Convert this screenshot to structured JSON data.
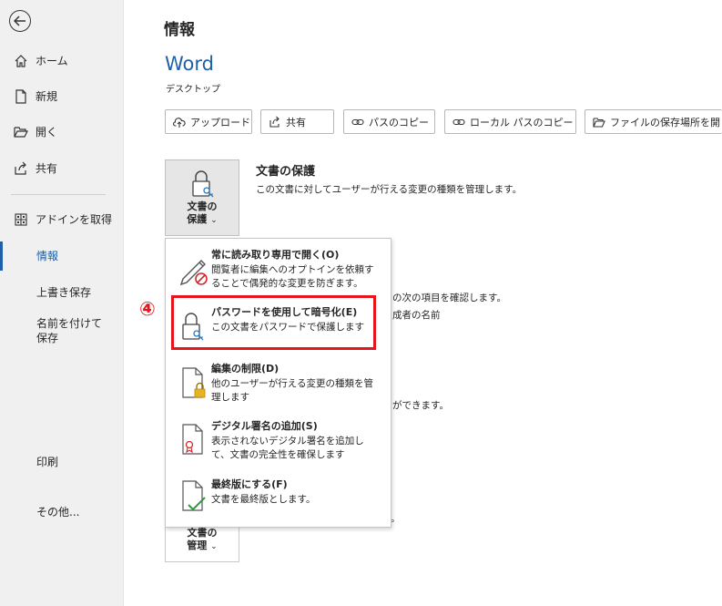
{
  "sidebar": {
    "home": "ホーム",
    "new": "新規",
    "open": "開く",
    "share": "共有",
    "get_addins": "アドインを取得",
    "info": "情報",
    "save": "上書き保存",
    "save_as": "名前を付けて保存",
    "print": "印刷",
    "more": "その他..."
  },
  "page": {
    "title": "情報",
    "app_name": "Word",
    "app_sub": "デスクトップ"
  },
  "toolbar": {
    "upload": "アップロード",
    "share": "共有",
    "copy_path": "パスのコピー",
    "copy_local_path": "ローカル パスのコピー",
    "open_location": "ファイルの保存場所を開"
  },
  "protect": {
    "button_label_1": "文書の",
    "button_label_2": "保護",
    "chevron": "⌄",
    "title": "文書の保護",
    "desc": "この文書に対してユーザーが行える変更の種類を管理します。"
  },
  "background": {
    "inspect_text": "の次の項目を確認します。",
    "author_text": "成者の名前",
    "versions_text": "ができます。",
    "browser_text": "。"
  },
  "manage": {
    "button_label_1": "文書の",
    "button_label_2": "管理"
  },
  "menu": {
    "items": [
      {
        "title": "常に読み取り専用で開く(O)",
        "desc": "閲覧者に編集へのオプトインを依頼することで偶発的な変更を防ぎます。"
      },
      {
        "title": "パスワードを使用して暗号化(E)",
        "desc": "この文書をパスワードで保護します"
      },
      {
        "title": "編集の制限(D)",
        "desc": "他のユーザーが行える変更の種類を管理します"
      },
      {
        "title": "デジタル署名の追加(S)",
        "desc": "表示されないデジタル署名を追加して、文書の完全性を確保します"
      },
      {
        "title": "最終版にする(F)",
        "desc": "文書を最終版とします。"
      }
    ]
  },
  "annotation": {
    "marker": "④",
    "color": "#e8141b"
  },
  "colors": {
    "accent": "#1f5fa9",
    "sidebar_bg": "#f0f0f0"
  }
}
